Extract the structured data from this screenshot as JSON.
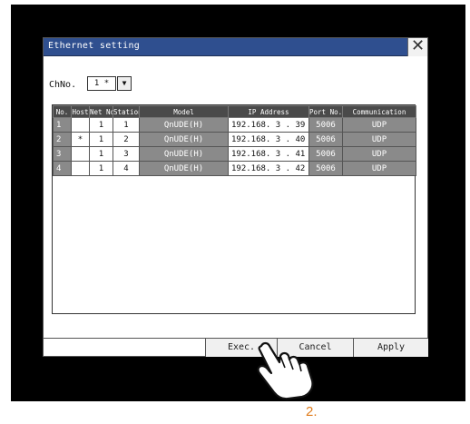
{
  "window": {
    "title": "Ethernet setting"
  },
  "channel": {
    "label": "ChNo.",
    "value": "1 *"
  },
  "table": {
    "headers": [
      "No.",
      "Host",
      "Net No.",
      "Station",
      "Model",
      "IP Address",
      "Port No.",
      "Communication"
    ],
    "rows": [
      [
        "1",
        "",
        "1",
        "1",
        "QnUDE(H)",
        "192.168. 3 . 39",
        "5006",
        "UDP"
      ],
      [
        "2",
        "*",
        "1",
        "2",
        "QnUDE(H)",
        "192.168. 3 . 40",
        "5006",
        "UDP"
      ],
      [
        "3",
        "",
        "1",
        "3",
        "QnUDE(H)",
        "192.168. 3 . 41",
        "5006",
        "UDP"
      ],
      [
        "4",
        "",
        "1",
        "4",
        "QnUDE(H)",
        "192.168. 3 . 42",
        "5006",
        "UDP"
      ]
    ]
  },
  "buttons": {
    "exec": "Exec.",
    "cancel": "Cancel",
    "apply": "Apply"
  },
  "annotation": {
    "step": "2."
  },
  "colors": {
    "titlebar": "#2f4f8f",
    "header": "#4a4a4a",
    "gray_cell": "#8a8a8a",
    "step_text": "#e07b1a"
  }
}
